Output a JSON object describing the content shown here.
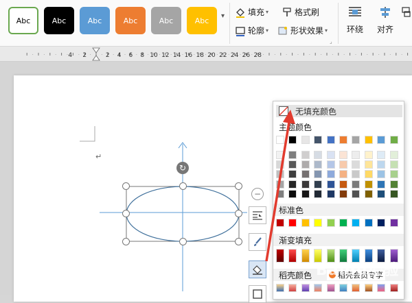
{
  "ribbon": {
    "style_swatches": [
      {
        "label": "Abc",
        "bg": "#ffffff",
        "fg": "#000000",
        "border": "#6aa84f"
      },
      {
        "label": "Abc",
        "bg": "#000000",
        "fg": "#ffffff",
        "border": "#000000"
      },
      {
        "label": "Abc",
        "bg": "#5b9bd5",
        "fg": "#ffffff",
        "border": "#5b9bd5"
      },
      {
        "label": "Abc",
        "bg": "#ed7d31",
        "fg": "#ffffff",
        "border": "#ed7d31"
      },
      {
        "label": "Abc",
        "bg": "#a5a5a5",
        "fg": "#ffffff",
        "border": "#a5a5a5"
      },
      {
        "label": "Abc",
        "bg": "#ffc000",
        "fg": "#ffffff",
        "border": "#ffc000"
      }
    ],
    "fill_label": "填充",
    "format_painter_label": "格式刷",
    "outline_label": "轮廓",
    "shape_effects_label": "形状效果",
    "wrap_label": "环绕",
    "align_label": "对齐"
  },
  "ruler": {
    "labels": [
      "4",
      "2",
      "2",
      "4",
      "6",
      "8",
      "10",
      "12",
      "14",
      "16",
      "18",
      "20",
      "22",
      "24",
      "26",
      "28"
    ]
  },
  "document": {
    "paragraph_mark": "↵"
  },
  "fill_menu": {
    "no_fill_label": "无填充颜色",
    "theme_colors_label": "主题颜色",
    "standard_colors_label": "标准色",
    "gradient_fill_label": "渐变填充",
    "docer_colors_label": "稻壳颜色",
    "docer_member_label": "稻壳会员专享",
    "theme_top": [
      "#ffffff",
      "#000000",
      "#e7e6e6",
      "#44546a",
      "#4472c4",
      "#ed7d31",
      "#a5a5a5",
      "#ffc000",
      "#5b9bd5",
      "#70ad47"
    ],
    "theme_shades": [
      [
        "#f2f2f2",
        "#7f7f7f",
        "#d0cece",
        "#d6dce4",
        "#d9e2f3",
        "#fbe4d5",
        "#ededed",
        "#fff2cc",
        "#deebf6",
        "#e2efd9"
      ],
      [
        "#d8d8d8",
        "#595959",
        "#aeabab",
        "#adb9ca",
        "#b4c6e7",
        "#f7caac",
        "#dbdbdb",
        "#fee599",
        "#bdd7ee",
        "#c5e0b3"
      ],
      [
        "#bfbfbf",
        "#3f3f3f",
        "#757070",
        "#8496b0",
        "#8eaadb",
        "#f4b183",
        "#c9c9c9",
        "#ffd965",
        "#9cc3e5",
        "#a8d08d"
      ],
      [
        "#a5a5a5",
        "#262626",
        "#3a3838",
        "#323f4f",
        "#2f5496",
        "#c55a11",
        "#7b7b7b",
        "#bf9000",
        "#2e75b5",
        "#538135"
      ],
      [
        "#7f7f7f",
        "#0c0c0c",
        "#171616",
        "#222a35",
        "#1f3864",
        "#833c0b",
        "#525252",
        "#7f6000",
        "#1e4e79",
        "#375623"
      ]
    ],
    "standard": [
      "#c00000",
      "#ff0000",
      "#ffc000",
      "#ffff00",
      "#92d050",
      "#00b050",
      "#00b0f0",
      "#0070c0",
      "#002060",
      "#7030a0"
    ],
    "gradient": [
      [
        "#c00000",
        "#600000"
      ],
      [
        "#ff4d4d",
        "#b00000"
      ],
      [
        "#ffd24d",
        "#d08a00"
      ],
      [
        "#ffff66",
        "#c9c900"
      ],
      [
        "#b6e07a",
        "#4f8f16"
      ],
      [
        "#3fd07a",
        "#0f7a3c"
      ],
      [
        "#50d0ff",
        "#0080b0"
      ],
      [
        "#3f8fdf",
        "#0b3f7f"
      ],
      [
        "#3f5fa0",
        "#0b1a40"
      ],
      [
        "#a060d0",
        "#4b1a7a"
      ]
    ],
    "docer": [
      [
        "#f7d08a",
        "#3f6fb0"
      ],
      [
        "#f6b0a0",
        "#d04040"
      ],
      [
        "#c090e0",
        "#6040b0"
      ],
      [
        "#a0c8f0",
        "#f08060"
      ],
      [
        "#f0a0c0",
        "#a05090"
      ],
      [
        "#7fd0e0",
        "#3f80c0"
      ],
      [
        "#f0c080",
        "#e06030"
      ],
      [
        "#ffd080",
        "#a05020"
      ],
      [
        "#80a0f0",
        "#f06080"
      ],
      [
        "#f08080",
        "#a02020"
      ]
    ]
  },
  "colors": {
    "accent_blue": "#5b9bd5",
    "arrow_red": "#e23b2e"
  },
  "watermark": "Baidu经验"
}
